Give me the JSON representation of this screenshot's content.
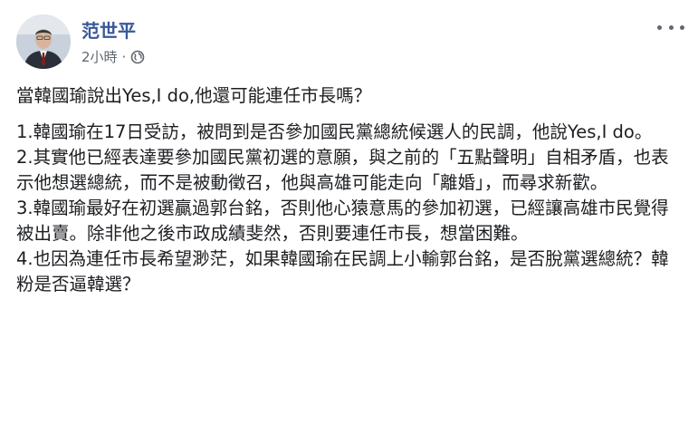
{
  "post": {
    "author_name": "范世平",
    "timestamp": "2小時",
    "separator": "·",
    "privacy_icon": "globe-icon",
    "more_icon": "more-options-icon",
    "lead": "當韓國瑜說出Yes,I do,他還可能連任市長嗎？",
    "items": [
      "1.韓國瑜在17日受訪，被問到是否參加國民黨總統候選人的民調，他說Yes,I do。",
      "2.其實他已經表達要參加國民黨初選的意願，與之前的「五點聲明」自相矛盾，也表示他想選總統，而不是被動徵召，他與高雄可能走向「離婚」，而尋求新歡。",
      "3.韓國瑜最好在初選贏過郭台銘，否則他心猿意馬的參加初選，已經讓高雄市民覺得被出賣。除非他之後市政成績斐然，否則要連任市長，想當困難。",
      "4.也因為連任市長希望渺茫，如果韓國瑜在民調上小輸郭台銘，是否脫黨選總統？韓粉是否逼韓選？"
    ]
  },
  "colors": {
    "name": "#385898",
    "meta": "#606770",
    "text": "#1c1e21"
  }
}
